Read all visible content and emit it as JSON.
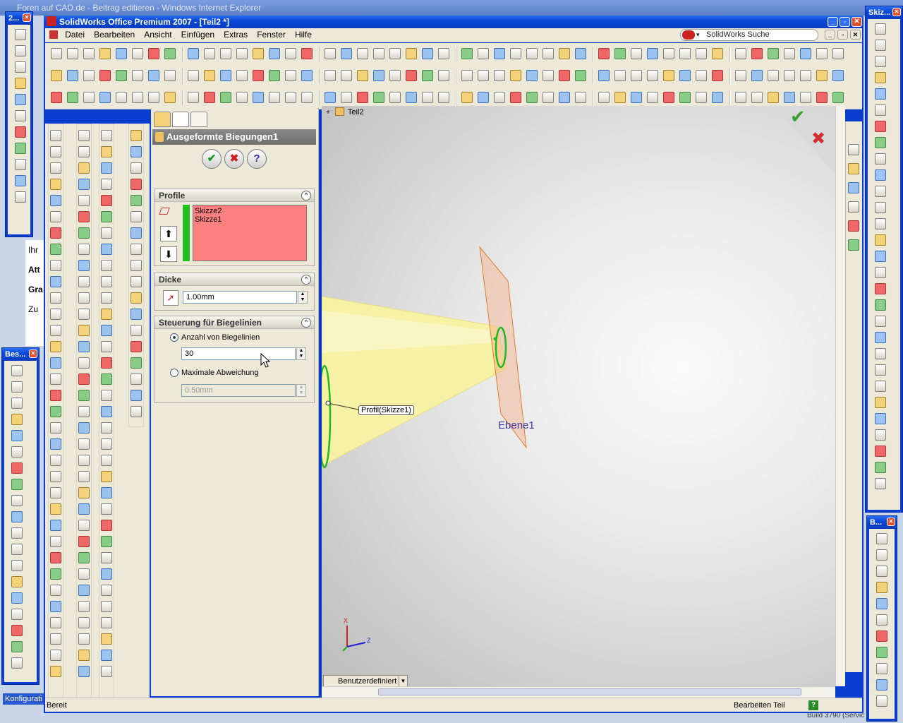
{
  "background_window": {
    "title": "Foren auf CAD.de - Beitrag editieren - Windows Internet Explorer",
    "side_texts": [
      "Ihr",
      "Att",
      "Gra",
      "Zu"
    ],
    "taskbar_label": "Konfigurati",
    "build_text": "Build 3790 (Servic"
  },
  "app": {
    "title": "SolidWorks Office Premium 2007 - [Teil2 *]",
    "search_placeholder": "SolidWorks Suche"
  },
  "menus": [
    "Datei",
    "Bearbeiten",
    "Ansicht",
    "Einfügen",
    "Extras",
    "Fenster",
    "Hilfe"
  ],
  "property_manager": {
    "header": "Ausgeformte Biegungen1",
    "ok_glyph": "✔",
    "cancel_glyph": "✖",
    "help_glyph": "?",
    "profile": {
      "title": "Profile",
      "items": [
        "Skizze2",
        "Skizze1"
      ],
      "move_up_glyph": "⬆",
      "move_down_glyph": "⬇"
    },
    "thickness": {
      "title": "Dicke",
      "value": "1.00mm"
    },
    "bend_control": {
      "title": "Steuerung für Biegelinien",
      "option1_label": "Anzahl von Biegelinien",
      "option1_value": "30",
      "option1_selected": true,
      "option2_label": "Maximale Abweichung",
      "option2_value": "0.50mm"
    },
    "collapse_glyph": "⌃"
  },
  "feature_tree": {
    "root": "Teil2",
    "expand_glyph": "+"
  },
  "viewport": {
    "callout_label": "Profil(Skizze1)",
    "plane_label": "Ebene1",
    "view_dropdown": "Benutzerdefiniert",
    "confirm_ok": "✔",
    "confirm_cancel": "✖",
    "axis_x": "X",
    "axis_z": "Z"
  },
  "status": {
    "left": "Bereit",
    "right": "Bearbeiten Teil",
    "help_glyph": "?"
  },
  "floating_toolbars": {
    "top_left": "2...",
    "mid_left": "Bes...",
    "top_right": "Skiz...",
    "bottom_right": "B..."
  },
  "colors": {
    "xp_blue": "#0a3cd0",
    "profile_list_bg": "#ff8080",
    "cone_yellow": "#f5f0a0",
    "plane_orange": "#f4b08a",
    "sketch_green": "#22b822"
  }
}
